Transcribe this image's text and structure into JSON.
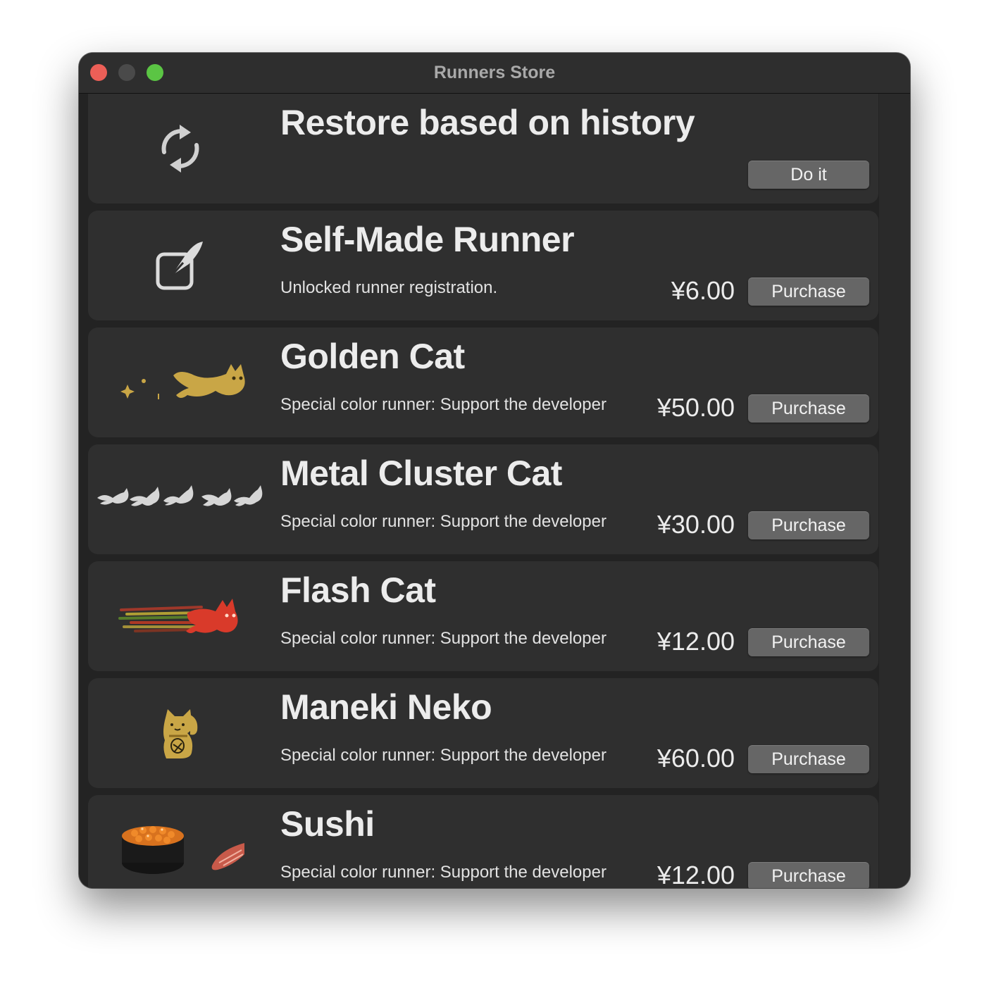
{
  "window": {
    "title": "Runners Store"
  },
  "items": [
    {
      "title": "Restore based on history",
      "description": "",
      "price": "",
      "button": "Do it",
      "icon": "refresh-icon"
    },
    {
      "title": "Self-Made Runner",
      "description": "Unlocked runner registration.",
      "price": "¥6.00",
      "button": "Purchase",
      "icon": "edit-icon"
    },
    {
      "title": "Golden Cat",
      "description": "Special color runner: Support the developer",
      "price": "¥50.00",
      "button": "Purchase",
      "icon": "golden-cat-icon"
    },
    {
      "title": "Metal Cluster Cat",
      "description": "Special color runner: Support the developer",
      "price": "¥30.00",
      "button": "Purchase",
      "icon": "metal-cluster-cat-icon"
    },
    {
      "title": "Flash Cat",
      "description": "Special color runner: Support the developer",
      "price": "¥12.00",
      "button": "Purchase",
      "icon": "flash-cat-icon"
    },
    {
      "title": "Maneki Neko",
      "description": "Special color runner: Support the developer",
      "price": "¥60.00",
      "button": "Purchase",
      "icon": "maneki-neko-icon"
    },
    {
      "title": "Sushi",
      "description": "Special color runner: Support the developer",
      "price": "¥12.00",
      "button": "Purchase",
      "icon": "sushi-icon"
    }
  ],
  "colors": {
    "close": "#ec5f57",
    "minimize": "#4a4a4a",
    "zoom": "#5bc544",
    "card": "#2f2f2f",
    "button": "#666666"
  }
}
